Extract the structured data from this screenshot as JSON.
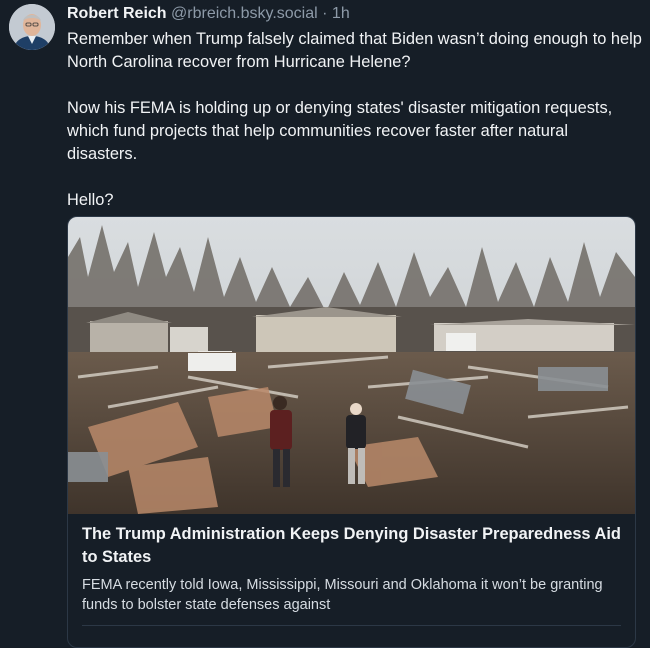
{
  "post": {
    "author_name": "Robert Reich",
    "author_handle": "@rbreich.bsky.social",
    "separator": "·",
    "timestamp": "1h",
    "paragraphs": [
      "Remember when Trump falsely claimed that Biden wasn’t doing enough to help North Carolina recover from Hurricane Helene?",
      "Now his FEMA is holding up or denying states' disaster mitigation requests, which fund projects that help communities recover faster after natural disasters.",
      "Hello?"
    ]
  },
  "link_card": {
    "image": "tornado-debris-photo",
    "title": "The Trump Administration Keeps Denying Disaster Preparedness Aid to States",
    "description": "FEMA recently told Iowa, Mississippi, Missouri and Oklahoma it won’t be granting funds to bolster state defenses against"
  },
  "colors": {
    "background": "#161e27",
    "text": "#f1f3f5",
    "muted": "#8d9aa8",
    "card_border": "#2c3846"
  }
}
